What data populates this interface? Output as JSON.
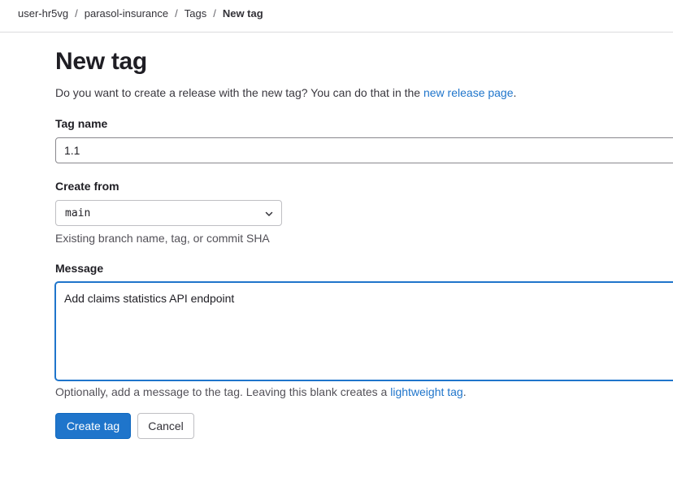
{
  "breadcrumb": {
    "items": [
      "user-hr5vg",
      "parasol-insurance",
      "Tags"
    ],
    "current": "New tag",
    "separator": "/"
  },
  "page": {
    "title": "New tag",
    "intro_text": "Do you want to create a release with the new tag? You can do that in the ",
    "intro_link": "new release page",
    "intro_end": "."
  },
  "tag_name": {
    "label": "Tag name",
    "value": "1.1"
  },
  "create_from": {
    "label": "Create from",
    "selected": "main",
    "help": "Existing branch name, tag, or commit SHA"
  },
  "message": {
    "label": "Message",
    "value": "Add claims statistics API endpoint",
    "help_text": "Optionally, add a message to the tag. Leaving this blank creates a ",
    "help_link": "lightweight tag",
    "help_end": "."
  },
  "actions": {
    "create_label": "Create tag",
    "cancel_label": "Cancel"
  },
  "colors": {
    "primary": "#1f75cb",
    "link": "#1f75cb"
  }
}
